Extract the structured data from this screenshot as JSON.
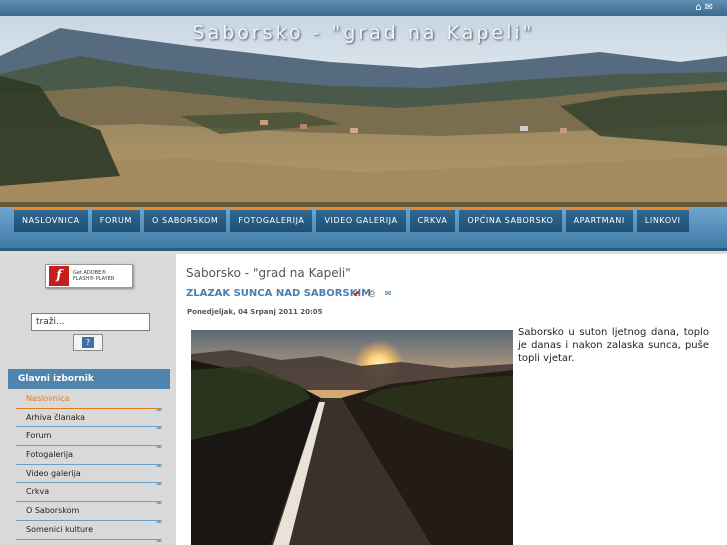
{
  "top_icons": [
    {
      "name": "home-icon",
      "glyph": "⌂"
    },
    {
      "name": "mail-icon",
      "glyph": "✉"
    }
  ],
  "site": {
    "title": "Saborsko - \"grad na Kapeli\""
  },
  "nav": {
    "items": [
      "NASLOVNICA",
      "FORUM",
      "O SABORSKOM",
      "FOTOGALERIJA",
      "VIDEO GALERIJA",
      "CRKVA",
      "OPĆINA SABORSKO",
      "APARTMANI",
      "LINKOVI"
    ]
  },
  "flash_badge": {
    "line1": "Get ADOBE®",
    "line2": "FLASH® PLAYER"
  },
  "search": {
    "placeholder": "traži...",
    "button_glyph": "?"
  },
  "main_menu": {
    "title": "Glavni izbornik",
    "items": [
      "Naslovnica",
      "Arhiva članaka",
      "Forum",
      "Fotogalerija",
      "Video galerija",
      "Crkva",
      "O Saborskom",
      "Somenici kulture"
    ]
  },
  "article": {
    "page_heading": "Saborsko - \"grad na Kapeli\"",
    "title": "ZLAZAK SUNCA NAD SABORSKIM",
    "date": "Ponedjeljak, 04 Srpanj 2011 20:05",
    "text": "Saborsko u suton ljetnog dana, toplo je danas i nakon zalaska sunca, puše topli vjetar.",
    "icons": [
      "pdf-icon",
      "print-icon",
      "email-icon"
    ]
  },
  "colors": {
    "accent_orange": "#e07a1f",
    "nav_blue": "#2f6892",
    "link_blue": "#4a7fae"
  }
}
